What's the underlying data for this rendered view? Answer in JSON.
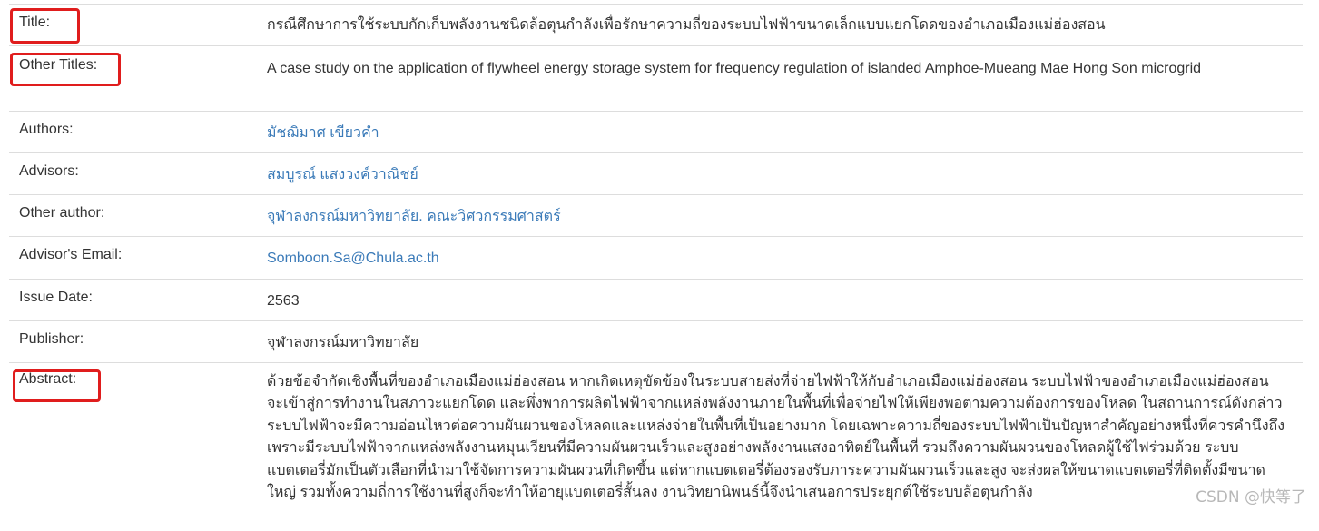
{
  "rows": [
    {
      "label": "Title:",
      "value": "กรณีศึกษาการใช้ระบบกักเก็บพลังงานชนิดล้อตุนกำลังเพื่อรักษาความถี่ของระบบไฟฟ้าขนาดเล็กแบบแยกโดดของอำเภอเมืองแม่ฮ่องสอน"
    },
    {
      "label": "Other Titles:",
      "value": "A case study on the application of flywheel energy storage system for frequency regulation of islanded Amphoe-Mueang Mae Hong Son microgrid"
    },
    {
      "label": "Authors:",
      "value": "มัชฌิมาศ เขียวคำ"
    },
    {
      "label": "Advisors:",
      "value": "สมบูรณ์ แสงวงค์วาณิชย์"
    },
    {
      "label": "Other author:",
      "value": "จุฬาลงกรณ์มหาวิทยาลัย. คณะวิศวกรรมศาสตร์"
    },
    {
      "label": "Advisor's Email:",
      "value": "Somboon.Sa@Chula.ac.th"
    },
    {
      "label": "Issue Date:",
      "value": "2563"
    },
    {
      "label": "Publisher:",
      "value": "จุฬาลงกรณ์มหาวิทยาลัย"
    },
    {
      "label": "Abstract:",
      "value": "ด้วยข้อจำกัดเชิงพื้นที่ของอำเภอเมืองแม่ฮ่องสอน หากเกิดเหตุขัดข้องในระบบสายส่งที่จ่ายไฟฟ้าให้กับอำเภอเมืองแม่ฮ่องสอน ระบบไฟฟ้าของอำเภอเมืองแม่ฮ่องสอนจะเข้าสู่การทำงานในสภาวะแยกโดด และพึ่งพาการผลิตไฟฟ้าจากแหล่งพลังงานภายในพื้นที่เพื่อจ่ายไฟให้เพียงพอตามความต้องการของโหลด ในสถานการณ์ดังกล่าวระบบไฟฟ้าจะมีความอ่อนไหวต่อความผันผวนของโหลดและแหล่งจ่ายในพื้นที่เป็นอย่างมาก โดยเฉพาะความถี่ของระบบไฟฟ้าเป็นปัญหาสำคัญอย่างหนึ่งที่ควรคำนึงถึง เพราะมีระบบไฟฟ้าจากแหล่งพลังงานหมุนเวียนที่มีความผันผวนเร็วและสูงอย่างพลังงานแสงอาทิตย์ในพื้นที่ รวมถึงความผันผวนของโหลดผู้ใช้ไฟร่วมด้วย ระบบแบตเตอรี่มักเป็นตัวเลือกที่นำมาใช้จัดการความผันผวนที่เกิดขึ้น แต่หากแบตเตอรี่ต้องรองรับภาระความผันผวนเร็วและสูง จะส่งผลให้ขนาดแบตเตอรี่ที่ติดตั้งมีขนาดใหญ่ รวมทั้งความถี่การใช้งานที่สูงก็จะทำให้อายุแบตเตอรี่สั้นลง งานวิทยานิพนธ์นี้จึงนำเสนอการประยุกต์ใช้ระบบล้อตุนกำลัง"
    }
  ],
  "watermark": "CSDN @快等了"
}
